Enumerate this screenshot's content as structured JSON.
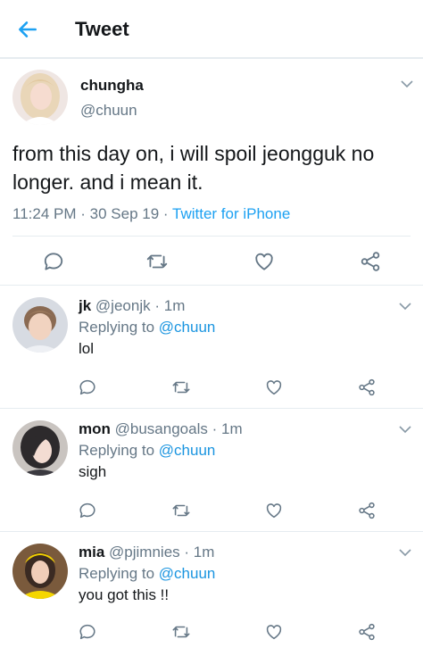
{
  "header": {
    "title": "Tweet",
    "back_icon": "arrow-left-icon"
  },
  "tweet": {
    "name": "chungha",
    "handle": "@chuun",
    "text": "from this day on, i will spoil jeongguk no longer. and i mean it.",
    "time": "11:24 PM",
    "date": "30 Sep 19",
    "source": "Twitter for iPhone",
    "meta_dot": "·",
    "actions": [
      "reply-icon",
      "retweet-icon",
      "like-icon",
      "share-icon"
    ]
  },
  "replies": [
    {
      "name": "jk",
      "handle": "@jeonjk",
      "dot": "·",
      "time": "1m",
      "replying_prefix": "Replying to",
      "mention": "@chuun",
      "text": "lol"
    },
    {
      "name": "mon",
      "handle": "@busangoals",
      "dot": "·",
      "time": "1m",
      "replying_prefix": "Replying to",
      "mention": "@chuun",
      "text": "sigh"
    },
    {
      "name": "mia",
      "handle": "@pjimnies",
      "dot": "·",
      "time": "1m",
      "replying_prefix": "Replying to",
      "mention": "@chuun",
      "text": "you got this !!"
    }
  ],
  "colors": {
    "accent": "#1da1f2",
    "secondary_text": "#657786",
    "primary_text": "#14171a",
    "divider": "#e6ecf0"
  }
}
